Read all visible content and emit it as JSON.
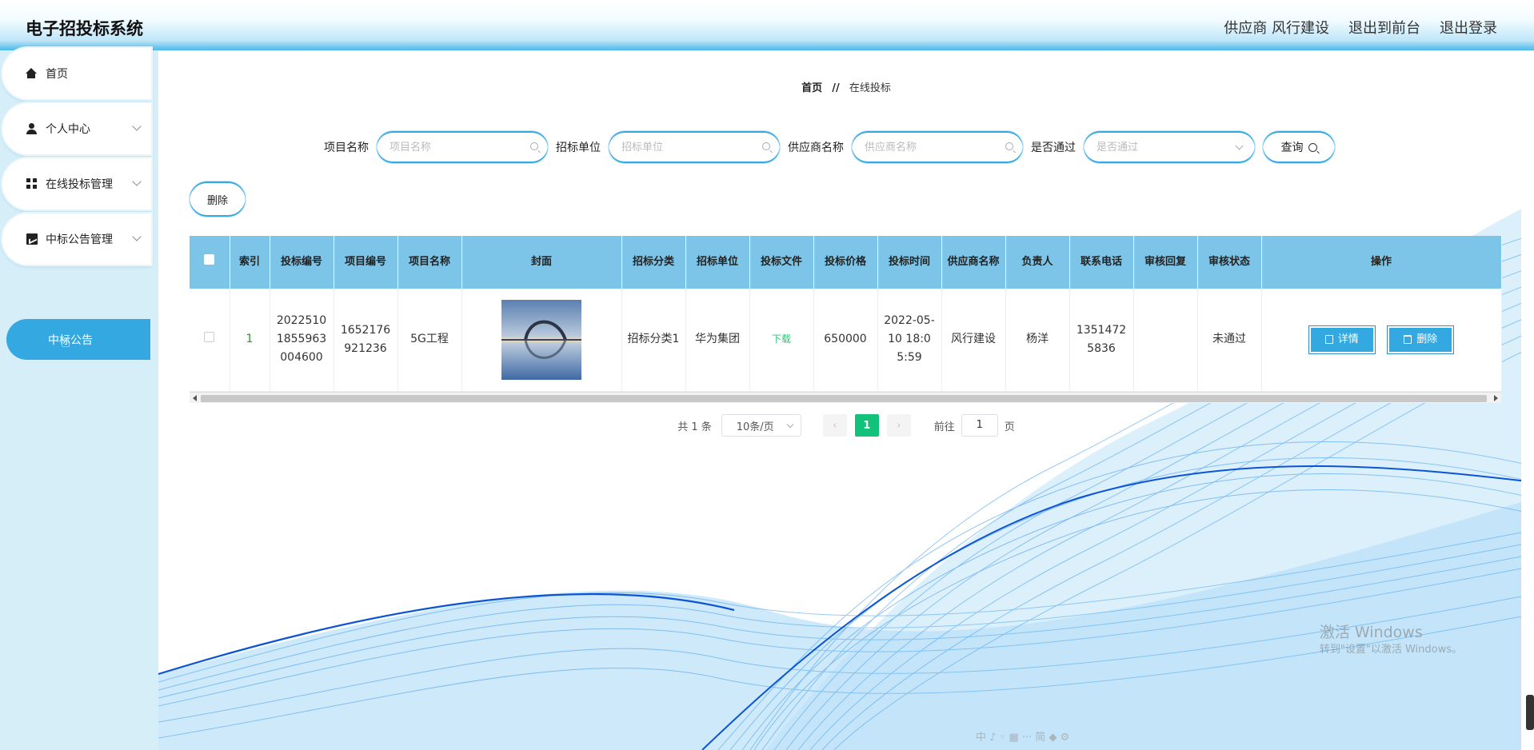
{
  "app": {
    "title": "电子招投标系统"
  },
  "header": {
    "user": "供应商 风行建设",
    "to_front": "退出到前台",
    "logout": "退出登录"
  },
  "sidebar": {
    "items": [
      {
        "label": "首页",
        "icon": "home-icon"
      },
      {
        "label": "个人中心",
        "icon": "user-icon"
      },
      {
        "label": "在线投标管理",
        "icon": "grid-icon"
      },
      {
        "label": "中标公告管理",
        "icon": "chart-icon"
      }
    ],
    "active_sub": "中标公告"
  },
  "breadcrumb": {
    "home": "首页",
    "sep": "//",
    "current": "在线投标"
  },
  "search": {
    "project_name_label": "项目名称",
    "project_name_placeholder": "项目名称",
    "tender_unit_label": "招标单位",
    "tender_unit_placeholder": "招标单位",
    "supplier_label": "供应商名称",
    "supplier_placeholder": "供应商名称",
    "passed_label": "是否通过",
    "passed_placeholder": "是否通过",
    "query_label": "查询"
  },
  "toolbar": {
    "delete_label": "删除"
  },
  "table": {
    "columns": [
      "索引",
      "投标编号",
      "项目编号",
      "项目名称",
      "封面",
      "招标分类",
      "招标单位",
      "投标文件",
      "投标价格",
      "投标时间",
      "供应商名称",
      "负责人",
      "联系电话",
      "审核回复",
      "审核状态",
      "操作"
    ],
    "rows": [
      {
        "index": "1",
        "bid_no": "20225101855963004600",
        "project_no": "1652176921236",
        "project_name": "5G工程",
        "category": "招标分类1",
        "tender_unit": "华为集团",
        "file": "下载",
        "price": "650000",
        "time": "2022-05-10 18:05:59",
        "supplier": "风行建设",
        "owner": "杨洋",
        "phone": "13514725836",
        "reply": "",
        "status": "未通过",
        "detail_label": "详情",
        "delete_label": "删除"
      }
    ]
  },
  "pagination": {
    "total": "共 1 条",
    "page_size": "10条/页",
    "current": "1",
    "goto_label": "前往",
    "goto_value": "1",
    "page_suffix": "页"
  },
  "watermark": {
    "line1": "激活 Windows",
    "line2": "转到\"设置\"以激活 Windows。"
  },
  "ime": "中 ♪ ◦ ▦ ··· 简 ◆ ⚙",
  "colors": {
    "accent": "#34a8e0",
    "header_table": "#7cc5e8",
    "sidebar_bg": "#d6eef8",
    "page_active": "#13c27a"
  }
}
